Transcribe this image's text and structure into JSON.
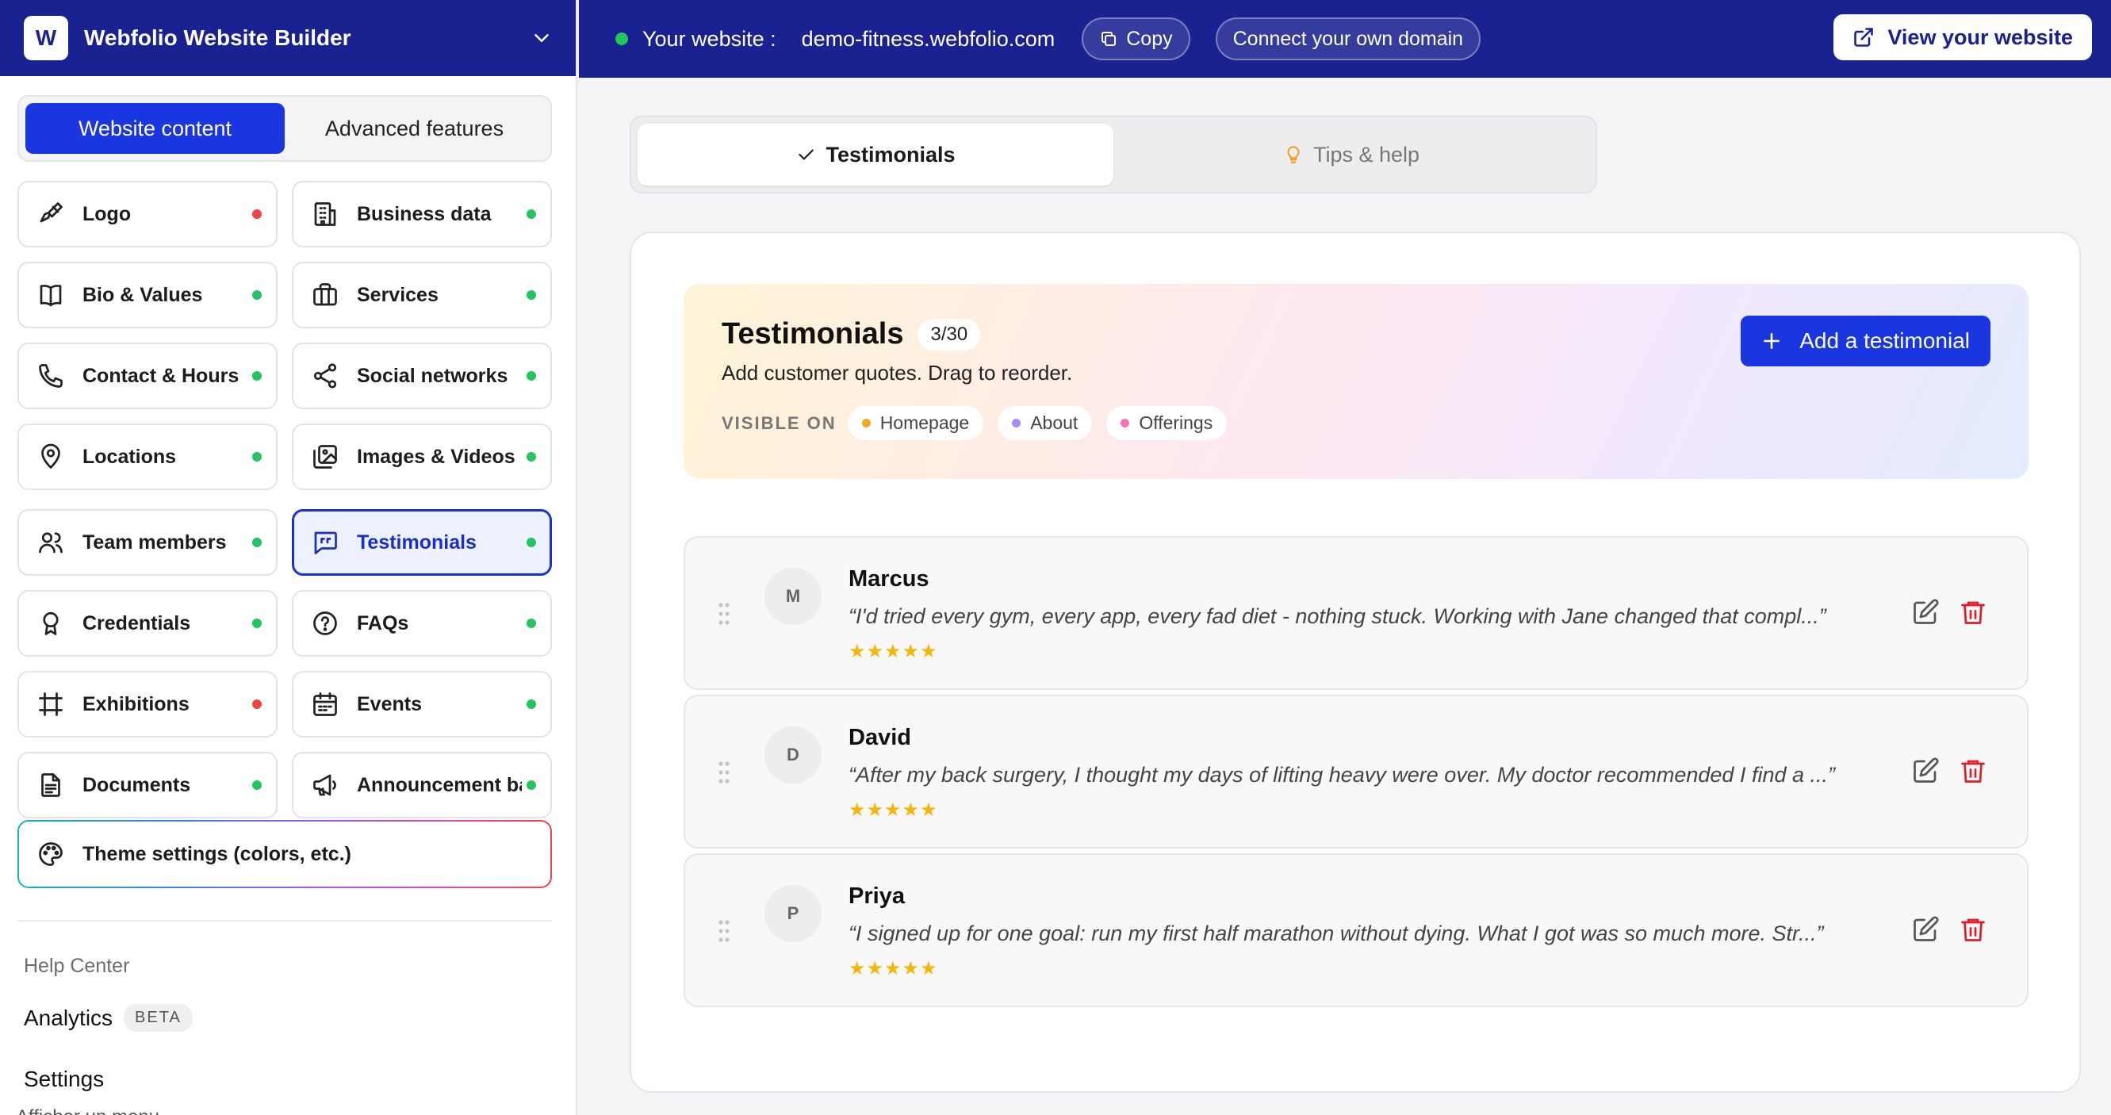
{
  "brand": {
    "logo_letter": "W",
    "name": "Webfolio Website Builder",
    "chevron_icon": "chevron-down-icon"
  },
  "mode_tabs": [
    {
      "label": "Website content",
      "active": true
    },
    {
      "label": "Advanced features",
      "active": false
    }
  ],
  "sections": [
    {
      "label": "Logo",
      "icon": "brush-icon",
      "status": "red"
    },
    {
      "label": "Business data",
      "icon": "building-icon",
      "status": "green"
    },
    {
      "label": "Bio & Values",
      "icon": "book-icon",
      "status": "green"
    },
    {
      "label": "Services",
      "icon": "briefcase-icon",
      "status": "green"
    },
    {
      "label": "Contact & Hours",
      "icon": "phone-icon",
      "status": "green"
    },
    {
      "label": "Social networks",
      "icon": "share-icon",
      "status": "green"
    },
    {
      "label": "Locations",
      "icon": "map-pin-icon",
      "status": "green"
    },
    {
      "label": "Images & Videos",
      "icon": "images-icon",
      "status": "green"
    },
    {
      "label": "Team members",
      "icon": "users-icon",
      "status": "green"
    },
    {
      "label": "Testimonials",
      "icon": "quote-icon",
      "status": "green",
      "active": true
    },
    {
      "label": "Credentials",
      "icon": "award-icon",
      "status": "green"
    },
    {
      "label": "FAQs",
      "icon": "help-circle-icon",
      "status": "green"
    },
    {
      "label": "Exhibitions",
      "icon": "frame-icon",
      "status": "red"
    },
    {
      "label": "Events",
      "icon": "calendar-icon",
      "status": "green"
    },
    {
      "label": "Documents",
      "icon": "document-icon",
      "status": "green"
    },
    {
      "label": "Announcement bar",
      "icon": "megaphone-icon",
      "status": "green"
    }
  ],
  "theme_settings": {
    "label": "Theme settings (colors, etc.)",
    "icon": "palette-icon"
  },
  "sidebar_footer": {
    "help_center": "Help Center",
    "analytics": "Analytics",
    "beta": "BETA",
    "settings": "Settings",
    "cut_text": "Afficher un menu"
  },
  "topbar": {
    "site_label": "Your website :",
    "site_url": "demo-fitness.webfolio.com",
    "copy": "Copy",
    "connect_domain": "Connect your own domain",
    "view_website": "View your website"
  },
  "main_tabs": [
    {
      "label": "Testimonials",
      "icon": "check-icon",
      "active": true
    },
    {
      "label": "Tips & help",
      "icon": "lightbulb-icon",
      "active": false
    }
  ],
  "hero": {
    "title": "Testimonials",
    "count": "3/30",
    "subtitle": "Add customer quotes. Drag to reorder.",
    "visible_label": "VISIBLE ON",
    "visible_on": [
      {
        "label": "Homepage",
        "color": "#f5a623"
      },
      {
        "label": "About",
        "color": "#a78bfa"
      },
      {
        "label": "Offerings",
        "color": "#f472b6"
      }
    ],
    "add_button": "Add a testimonial"
  },
  "testimonials": [
    {
      "initial": "M",
      "name": "Marcus",
      "quote": "“I'd tried every gym, every app, every fad diet - nothing stuck. Working with Jane changed that compl...”",
      "rating": 5
    },
    {
      "initial": "D",
      "name": "David",
      "quote": "“After my back surgery, I thought my days of lifting heavy were over. My doctor recommended I find a ...”",
      "rating": 5
    },
    {
      "initial": "P",
      "name": "Priya",
      "quote": "“I signed up for one goal: run my first half marathon without dying. What I got was so much more. Str...”",
      "rating": 5
    }
  ],
  "colors": {
    "brand": "#1a2190",
    "accent": "#1936e0",
    "active_status": "#22c55e",
    "inactive_status": "#ef4444",
    "delete": "#e11d2a",
    "star": "#f5b50a"
  }
}
